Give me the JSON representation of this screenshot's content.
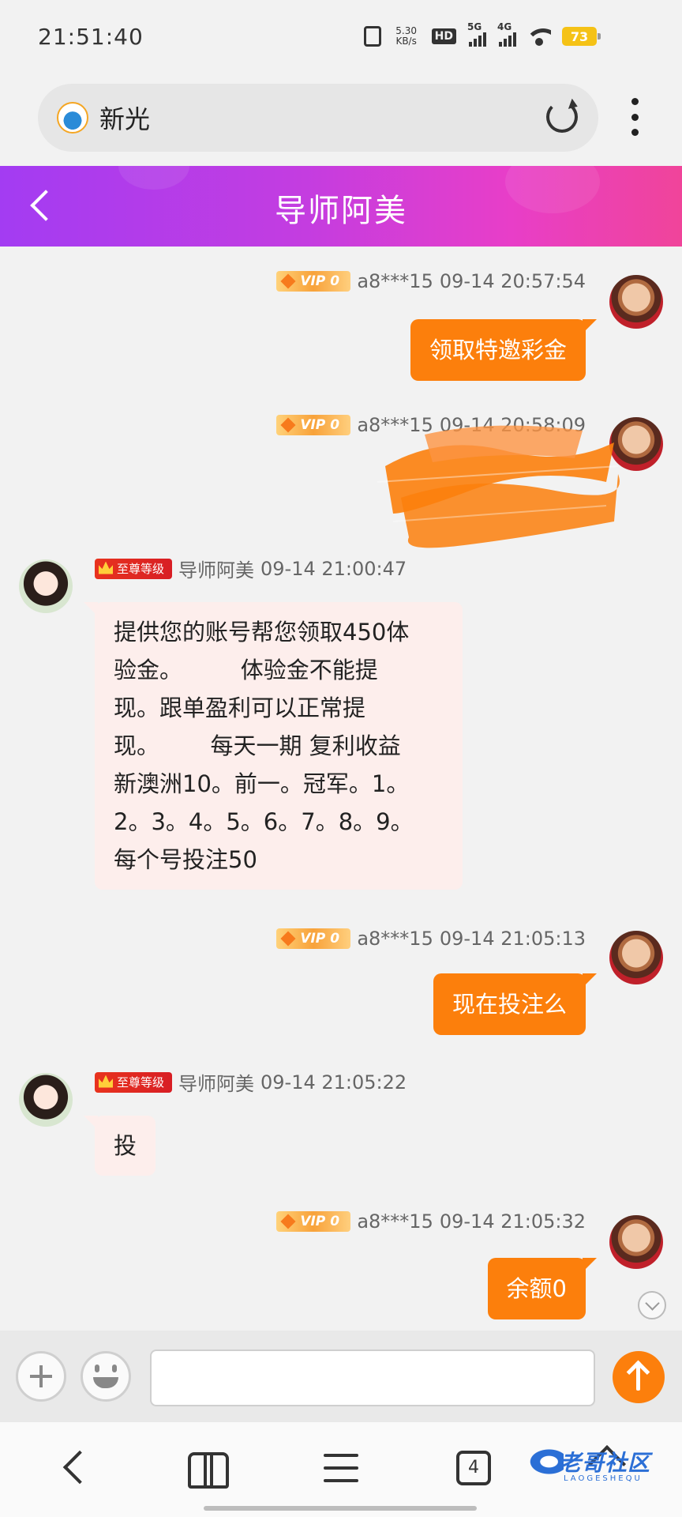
{
  "status_bar": {
    "time": "21:51:40",
    "net_speed": "5.30",
    "net_speed_unit": "KB/s",
    "hd_label": "HD",
    "sim1_label": "5G",
    "sim2_label": "4G",
    "battery": "73",
    "battery_color": "#f5c216"
  },
  "browser": {
    "site_name": "新光"
  },
  "header": {
    "title": "导师阿美",
    "gradient_start": "#a33cf2",
    "gradient_end": "#f0449a"
  },
  "messages": [
    {
      "direction": "out",
      "badge": "VIP 0",
      "sender": "a8***15",
      "time": "09-14 20:57:54",
      "text": "领取特邀彩金"
    },
    {
      "direction": "out",
      "badge": "VIP 0",
      "sender": "a8***15",
      "time": "09-14 20:58:09",
      "text": "",
      "redacted": true
    },
    {
      "direction": "in",
      "badge": "至尊等级",
      "sender": "导师阿美",
      "time": "09-14 21:00:47",
      "lines": [
        "提供您的账号帮您领取450体",
        "验金。        体验金不能提",
        "现。跟单盈利可以正常提",
        "现。       每天一期 复利收益",
        "新澳洲10。前一。冠军。1。",
        "2。3。4。5。6。7。8。9。",
        "每个号投注50"
      ]
    },
    {
      "direction": "out",
      "badge": "VIP 0",
      "sender": "a8***15",
      "time": "09-14 21:05:13",
      "text": "现在投注么"
    },
    {
      "direction": "in",
      "badge": "至尊等级",
      "sender": "导师阿美",
      "time": "09-14 21:05:22",
      "text": "投"
    },
    {
      "direction": "out",
      "badge": "VIP 0",
      "sender": "a8***15",
      "time": "09-14 21:05:32",
      "text": "余额0"
    }
  ],
  "input": {
    "placeholder": "",
    "accent_color": "#fc7f0c"
  },
  "bottom_nav": {
    "tab_count": "4"
  },
  "watermark": {
    "text": "老哥社区",
    "sub": "LAOGESHEQU"
  }
}
